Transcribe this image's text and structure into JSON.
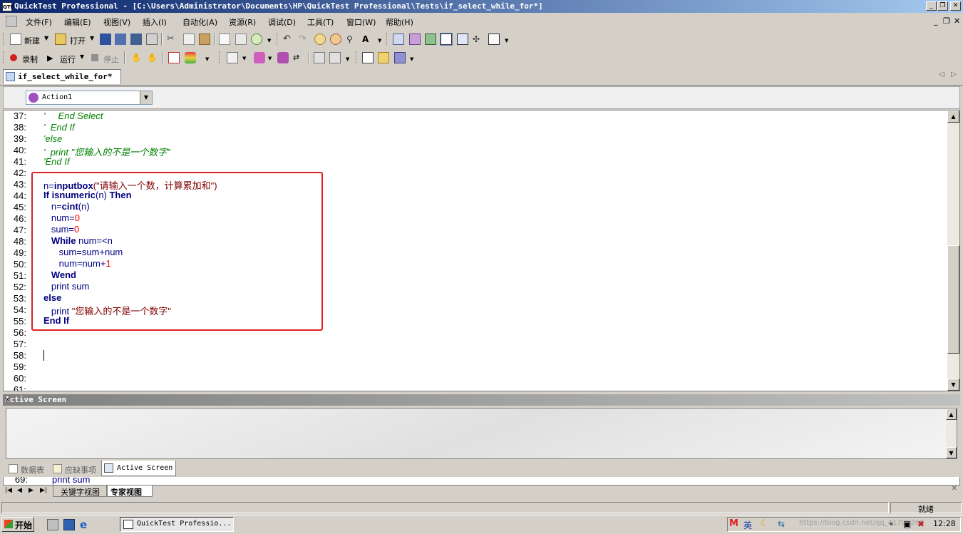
{
  "window": {
    "title": "QuickTest Professional - [C:\\Users\\Administrator\\Documents\\HP\\QuickTest Professional\\Tests\\if_select_while_for*]",
    "app_icon": "QTP"
  },
  "menu": {
    "items": [
      "文件(F)",
      "编辑(E)",
      "视图(V)",
      "插入(I)",
      "自动化(A)",
      "资源(R)",
      "调试(D)",
      "工具(T)",
      "窗口(W)",
      "帮助(H)"
    ]
  },
  "toolbar1": {
    "new_label": "新建",
    "open_label": "打开"
  },
  "toolbar2": {
    "record_label": "录制",
    "run_label": "运行",
    "stop_label": "停止"
  },
  "document_tab": {
    "label": "if_select_while_for*"
  },
  "action_selector": {
    "value": "Action1"
  },
  "editor": {
    "lines": [
      {
        "n": "37:",
        "text": "'     End Select",
        "cls": "cm"
      },
      {
        "n": "38:",
        "text": "'  End If",
        "cls": "cm"
      },
      {
        "n": "39:",
        "text": "'else",
        "cls": "cm"
      },
      {
        "n": "40:",
        "text": "'  print \"您输入的不是一个数字\"",
        "cls": "cm"
      },
      {
        "n": "41:",
        "text": "'End If",
        "cls": "cm"
      },
      {
        "n": "42:",
        "text": "",
        "cls": "pl"
      },
      {
        "n": "43:",
        "text": "",
        "cls": "pl"
      },
      {
        "n": "44:",
        "text": "",
        "cls": "pl"
      },
      {
        "n": "45:",
        "text": "",
        "cls": "pl"
      },
      {
        "n": "46:",
        "text": "",
        "cls": "pl"
      },
      {
        "n": "47:",
        "text": "",
        "cls": "pl"
      },
      {
        "n": "48:",
        "text": "",
        "cls": "pl"
      },
      {
        "n": "49:",
        "text": "",
        "cls": "pl"
      },
      {
        "n": "50:",
        "text": "",
        "cls": "pl"
      },
      {
        "n": "51:",
        "text": "",
        "cls": "pl"
      },
      {
        "n": "52:",
        "text": "",
        "cls": "pl"
      },
      {
        "n": "53:",
        "text": "",
        "cls": "pl"
      },
      {
        "n": "54:",
        "text": "",
        "cls": "pl"
      },
      {
        "n": "55:",
        "text": "",
        "cls": "pl"
      },
      {
        "n": "56:",
        "text": "",
        "cls": "pl"
      },
      {
        "n": "57:",
        "text": "",
        "cls": "pl"
      },
      {
        "n": "58:",
        "text": "",
        "cls": "pl"
      },
      {
        "n": "59:",
        "text": "",
        "cls": "pl"
      },
      {
        "n": "60:",
        "text": "",
        "cls": "pl"
      },
      {
        "n": "61:",
        "text": "",
        "cls": "pl"
      }
    ],
    "code_43": {
      "a": "n=",
      "b": "inputbox",
      "c": "(\"请输入一个数，计算累加和\")"
    },
    "code_44": {
      "a": "If ",
      "b": "isnumeric",
      "c": "(n) ",
      "d": "Then"
    },
    "code_45": {
      "a": "   n=",
      "b": "cint",
      "c": "(n)"
    },
    "code_46": {
      "a": "   num=",
      "b": "0"
    },
    "code_47": {
      "a": "   sum=",
      "b": "0"
    },
    "code_48": {
      "a": "   ",
      "b": "While",
      "c": " num=<n"
    },
    "code_49": {
      "a": "      sum=sum+num"
    },
    "code_50": {
      "a": "      num=num+",
      "b": "1"
    },
    "code_51": {
      "a": "   ",
      "b": "Wend"
    },
    "code_52": {
      "a": "   print sum"
    },
    "code_53": {
      "a": "else"
    },
    "code_54": {
      "a": "   print ",
      "b": "\"您输入的不是一个数字\""
    },
    "code_55": {
      "a": "End If"
    }
  },
  "active_screen": {
    "title": "Active Screen"
  },
  "bottom_tabs": [
    "数据表",
    "应缺事项",
    "Active Screen"
  ],
  "behind_text": {
    "line_no": "69:",
    "text": "print sum"
  },
  "view_tabs": [
    "关键字视图",
    "专家视图"
  ],
  "status": {
    "ready": "就绪"
  },
  "taskbar": {
    "start_label": "开始",
    "app_label": "QuickTest Professio...",
    "clock": "12:28",
    "ime_label": "英",
    "watermark": "https://blog.csdn.net/qq_41709265"
  },
  "colors": {
    "title_start": "#0a246a",
    "title_end": "#a6caf0",
    "highlight_box": "#e02020",
    "comment": "#008000",
    "keyword": "#000080"
  }
}
